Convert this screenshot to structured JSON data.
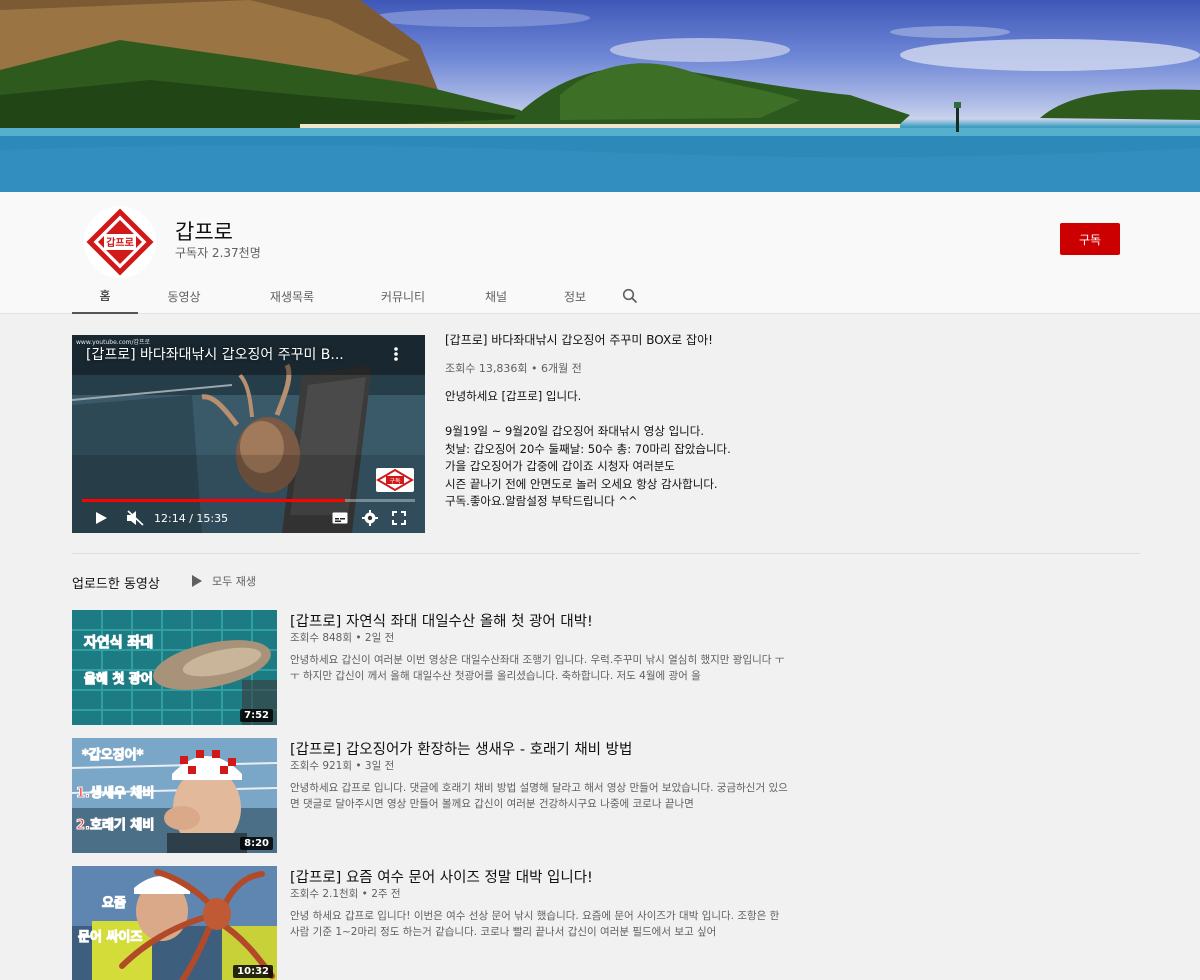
{
  "channel": {
    "name": "갑프로",
    "subscribers": "구독자 2.37천명",
    "subscribe_label": "구독",
    "logo_text": "갑프로",
    "brand_color": "#cc0000"
  },
  "tabs": [
    {
      "label": "홈",
      "active": true
    },
    {
      "label": "동영상"
    },
    {
      "label": "재생목록"
    },
    {
      "label": "커뮤니티"
    },
    {
      "label": "채널"
    },
    {
      "label": "정보"
    }
  ],
  "featured": {
    "url_watermark": "www.youtube.com/갑프로",
    "overlay_title": "[갑프로] 바다좌대낚시 갑오징어 주꾸미 B...",
    "time": "12:14 / 15:35",
    "progress": 0.79,
    "stamp_text": "구독",
    "title": "[갑프로] 바다좌대낚시 갑오징어 주꾸미 BOX로 잡아!",
    "meta": "조회수 13,836회 • 6개월 전",
    "description": [
      "안녕하세요 [갑프로] 입니다.",
      "",
      "9월19일 ~ 9월20일 갑오징어 좌대낚시 영상 입니다.",
      "첫날: 갑오징어 20수 둘째날: 50수 총: 70마리 잡았습니다.",
      "가을 갑오징어가 갑중에 갑이죠 시청자 여러분도",
      "시즌 끝나기 전에 안면도로 놀러 오세요 항상 감사합니다.",
      "구독.좋아요.알람설정 부탁드립니다 ^^"
    ]
  },
  "uploads": {
    "title": "업로드한 동영상",
    "play_all": "모두 재생",
    "videos": [
      {
        "title": "[갑프로] 자연식 좌대 대일수산 올해 첫 광어 대박!",
        "meta": "조회수 848회 • 2일 전",
        "description": "안녕하세요 갑신이 여러분 이번 영상은 대일수산좌대 조행기 입니다. 우럭.주꾸미 낚시 열심히 했지만 꽝입니다 ㅜㅜ 하지만 갑신이 께서 올해 대일수산 첫광어를 올리셨습니다. 축하합니다. 저도 4월에 광어 올",
        "duration": "7:52",
        "thumb_lines": [
          "자연식 좌대",
          "올해 첫 광어"
        ]
      },
      {
        "title": "[갑프로] 갑오징어가 환장하는 생새우 - 호래기 채비 방법",
        "meta": "조회수 921회 • 3일 전",
        "description": "안녕하세요 갑프로 입니다. 댓글에 호래기 채비 방법 설명해 달라고 해서 영상 만들어 보았습니다. 궁금하신거 있으면 댓글로 달아주시면 영상 만들어 볼께요 갑신이 여러분 건강하시구요 나중에 코로나 끝나면",
        "duration": "8:20",
        "thumb_lines": [
          "*갑오징어*",
          "1.생새우 채비",
          "2.호래기 채비"
        ]
      },
      {
        "title": "[갑프로] 요즘 여수 문어 사이즈 정말 대박 입니다!",
        "meta": "조회수 2.1천회 • 2주 전",
        "description": "안녕 하세요 갑프로 입니다! 이번은 여수 선상 문어 낚시 했습니다. 요즘에 문어 사이즈가 대박 입니다. 조항은 한사람 기준 1~2마리 정도 하는거 같습니다. 코로나 빨리 끝나서 갑신이 여러분 필드에서 보고 싶어",
        "duration": "10:32",
        "thumb_lines": [
          "요즘",
          "문어 싸이즈"
        ]
      }
    ]
  }
}
